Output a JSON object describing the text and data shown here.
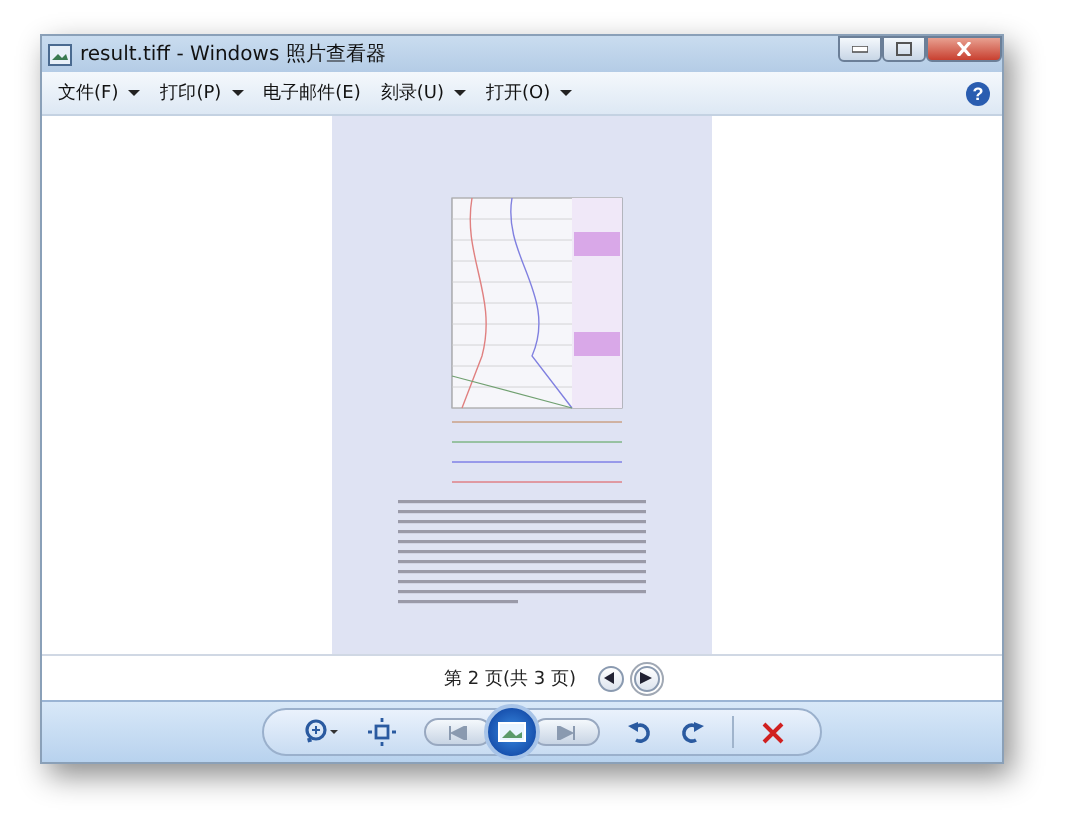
{
  "window": {
    "title": "result.tiff - Windows 照片查看器"
  },
  "menu": [
    {
      "label": "文件(F)",
      "dropdown": true
    },
    {
      "label": "打印(P)",
      "dropdown": true
    },
    {
      "label": "电子邮件(E)",
      "dropdown": false
    },
    {
      "label": "刻录(U)",
      "dropdown": true
    },
    {
      "label": "打开(O)",
      "dropdown": true
    }
  ],
  "help": {
    "label": "?"
  },
  "pager": {
    "text": "第 2 页(共 3 页)"
  }
}
